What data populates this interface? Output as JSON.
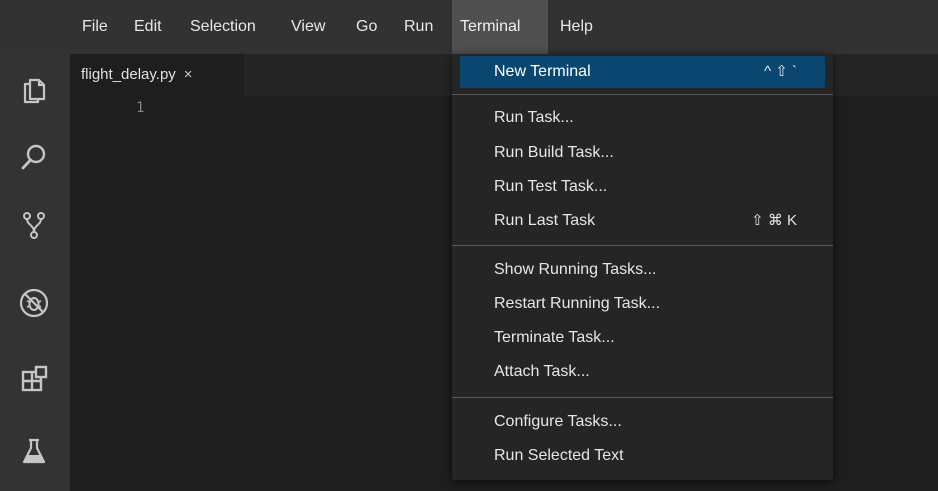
{
  "menubar": {
    "items": [
      {
        "label": "File"
      },
      {
        "label": "Edit"
      },
      {
        "label": "Selection"
      },
      {
        "label": "View"
      },
      {
        "label": "Go"
      },
      {
        "label": "Run"
      },
      {
        "label": "Terminal"
      },
      {
        "label": "Help"
      }
    ]
  },
  "activitybar": {
    "icons": [
      "explorer-icon",
      "search-icon",
      "source-control-icon",
      "debug-icon",
      "extensions-icon",
      "testing-icon"
    ]
  },
  "editor": {
    "tab": {
      "filename": "flight_delay.py",
      "close_glyph": "×"
    },
    "line_number": "1"
  },
  "terminal_menu": {
    "items": [
      {
        "label": "New Terminal",
        "shortcut": "^ ⇧ `"
      },
      {
        "label": "Run Task..."
      },
      {
        "label": "Run Build Task..."
      },
      {
        "label": "Run Test Task..."
      },
      {
        "label": "Run Last Task",
        "shortcut": "⇧ ⌘ K"
      },
      {
        "label": "Show Running Tasks..."
      },
      {
        "label": "Restart Running Task..."
      },
      {
        "label": "Terminate Task..."
      },
      {
        "label": "Attach Task..."
      },
      {
        "label": "Configure Tasks..."
      },
      {
        "label": "Run Selected Text"
      }
    ]
  },
  "colors": {
    "menubar_bg": "#323233",
    "activitybar_bg": "#333333",
    "editor_bg": "#1e1e1e",
    "menu_highlight": "#094771"
  }
}
